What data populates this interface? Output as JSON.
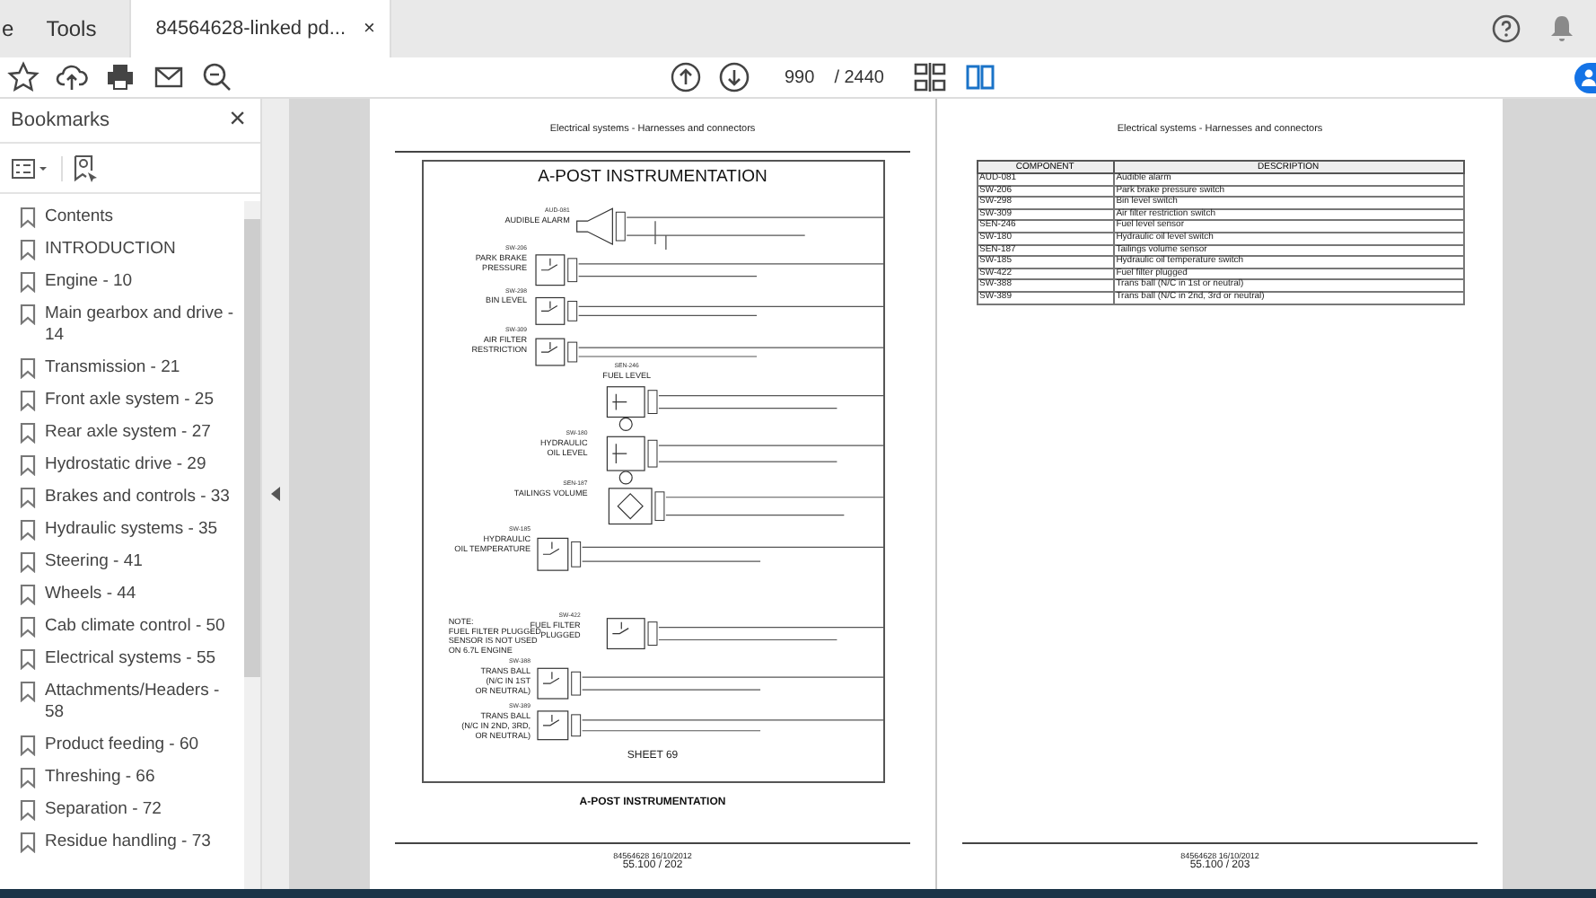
{
  "tabs": [
    {
      "label": "e",
      "selected": false
    },
    {
      "label": "Tools",
      "selected": false
    },
    {
      "label": "84564628-linked pd...",
      "selected": true,
      "close": "×"
    }
  ],
  "page_nav": {
    "current": "990",
    "total": "/ 2440"
  },
  "bookmarks": {
    "title": "Bookmarks",
    "close": "×",
    "items": [
      "Contents",
      "INTRODUCTION",
      "Engine - 10",
      "Main gearbox and drive - 14",
      "Transmission - 21",
      "Front axle system - 25",
      "Rear axle system - 27",
      "Hydrostatic drive - 29",
      "Brakes and controls - 33",
      "Hydraulic systems - 35",
      "Steering - 41",
      "Wheels - 44",
      "Cab climate control - 50",
      "Electrical systems - 55",
      "Attachments/Headers - 58",
      "Product feeding - 60",
      "Threshing - 66",
      "Separation - 72",
      "Residue handling - 73"
    ]
  },
  "left_page": {
    "header": "Electrical systems - Harnesses and connectors",
    "diagram_title": "A-POST INSTRUMENTATION",
    "components": [
      {
        "kind": "horn",
        "id": "AUD-081",
        "lines": [
          "AUDIBLE ALARM"
        ]
      },
      {
        "kind": "switch",
        "id": "SW-206",
        "lines": [
          "PARK BRAKE",
          "PRESSURE"
        ]
      },
      {
        "kind": "switch",
        "id": "SW-298",
        "lines": [
          "BIN LEVEL"
        ]
      },
      {
        "kind": "switch",
        "id": "SW-309",
        "lines": [
          "AIR FILTER",
          "RESTRICTION"
        ]
      },
      {
        "kind": "sensor",
        "id": "SEN-246",
        "lines": [
          "FUEL LEVEL"
        ]
      },
      {
        "kind": "sensor",
        "id": "SW-180",
        "lines": [
          "HYDRAULIC",
          "OIL LEVEL"
        ]
      },
      {
        "kind": "bridge",
        "id": "SEN-187",
        "lines": [
          "TAILINGS VOLUME"
        ]
      },
      {
        "kind": "switch",
        "id": "SW-185",
        "lines": [
          "HYDRAULIC",
          "OIL TEMPERATURE"
        ]
      },
      {
        "kind": "switch",
        "id": "SW-422",
        "lines": [
          "FUEL FILTER",
          "PLUGGED"
        ]
      },
      {
        "kind": "switch",
        "id": "SW-388",
        "lines": [
          "TRANS BALL",
          "(N/C IN 1ST",
          "OR NEUTRAL)"
        ]
      },
      {
        "kind": "switch",
        "id": "SW-389",
        "lines": [
          "TRANS BALL",
          "(N/C IN 2ND, 3RD,",
          "OR NEUTRAL)"
        ]
      }
    ],
    "note": [
      "NOTE:",
      "FUEL FILTER PLUGGED",
      "SENSOR IS NOT USED",
      "ON 6.7L ENGINE"
    ],
    "sheet": "SHEET 69",
    "caption": "A-POST INSTRUMENTATION",
    "footer_code": "84564628 16/10/2012",
    "footer_page": "55.100 / 202"
  },
  "right_page": {
    "header": "Electrical systems - Harnesses and connectors",
    "table": {
      "columns": [
        "COMPONENT",
        "DESCRIPTION"
      ],
      "rows": [
        [
          "AUD-081",
          "Audible alarm"
        ],
        [
          "SW-206",
          "Park brake pressure switch"
        ],
        [
          "SW-298",
          "Bin level switch"
        ],
        [
          "SW-309",
          "Air filter restriction switch"
        ],
        [
          "SEN-246",
          "Fuel level sensor"
        ],
        [
          "SW-180",
          "Hydraulic oil level switch"
        ],
        [
          "SEN-187",
          "Tailings volume sensor"
        ],
        [
          "SW-185",
          "Hydraulic oil temperature switch"
        ],
        [
          "SW-422",
          "Fuel filter plugged"
        ],
        [
          "SW-388",
          "Trans ball (N/C in 1st or neutral)"
        ],
        [
          "SW-389",
          "Trans ball (N/C in 2nd, 3rd or neutral)"
        ]
      ]
    },
    "footer_code": "84564628 16/10/2012",
    "footer_page": "55.100 / 203"
  }
}
